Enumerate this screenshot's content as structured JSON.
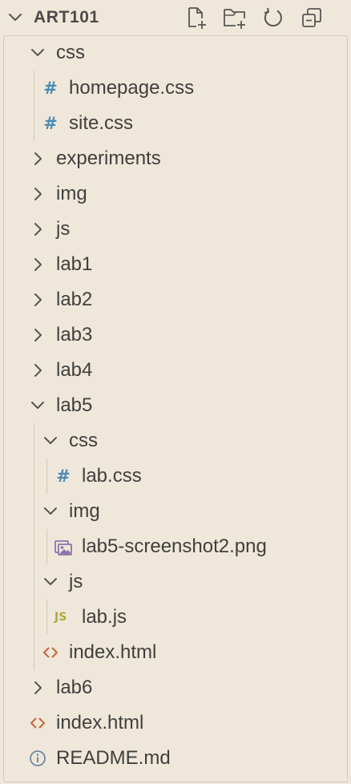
{
  "explorer": {
    "folder_title": "ART101",
    "actions": [
      {
        "name": "new-file-icon"
      },
      {
        "name": "new-folder-icon"
      },
      {
        "name": "refresh-icon"
      },
      {
        "name": "collapse-all-icon"
      }
    ]
  },
  "tree": [
    {
      "label": "css",
      "type": "folder",
      "expanded": true,
      "depth": 1
    },
    {
      "label": "homepage.css",
      "type": "css",
      "depth": 2
    },
    {
      "label": "site.css",
      "type": "css",
      "depth": 2
    },
    {
      "label": "experiments",
      "type": "folder",
      "expanded": false,
      "depth": 1
    },
    {
      "label": "img",
      "type": "folder",
      "expanded": false,
      "depth": 1
    },
    {
      "label": "js",
      "type": "folder",
      "expanded": false,
      "depth": 1
    },
    {
      "label": "lab1",
      "type": "folder",
      "expanded": false,
      "depth": 1
    },
    {
      "label": "lab2",
      "type": "folder",
      "expanded": false,
      "depth": 1
    },
    {
      "label": "lab3",
      "type": "folder",
      "expanded": false,
      "depth": 1
    },
    {
      "label": "lab4",
      "type": "folder",
      "expanded": false,
      "depth": 1
    },
    {
      "label": "lab5",
      "type": "folder",
      "expanded": true,
      "depth": 1
    },
    {
      "label": "css",
      "type": "folder",
      "expanded": true,
      "depth": 2
    },
    {
      "label": "lab.css",
      "type": "css",
      "depth": 3
    },
    {
      "label": "img",
      "type": "folder",
      "expanded": true,
      "depth": 2
    },
    {
      "label": "lab5-screenshot2.png",
      "type": "image",
      "depth": 3
    },
    {
      "label": "js",
      "type": "folder",
      "expanded": true,
      "depth": 2
    },
    {
      "label": "lab.js",
      "type": "js",
      "depth": 3
    },
    {
      "label": "index.html",
      "type": "html",
      "depth": 2
    },
    {
      "label": "lab6",
      "type": "folder",
      "expanded": false,
      "depth": 1
    },
    {
      "label": "index.html",
      "type": "html",
      "depth": 1
    },
    {
      "label": "README.md",
      "type": "info",
      "depth": 1
    }
  ],
  "colors": {
    "background": "#efe8da",
    "css_icon": "#4a8bb7",
    "html_icon": "#c76b3f",
    "js_icon": "#b2a83a",
    "image_icon": "#8f72ad",
    "info_icon": "#6b89a8"
  }
}
